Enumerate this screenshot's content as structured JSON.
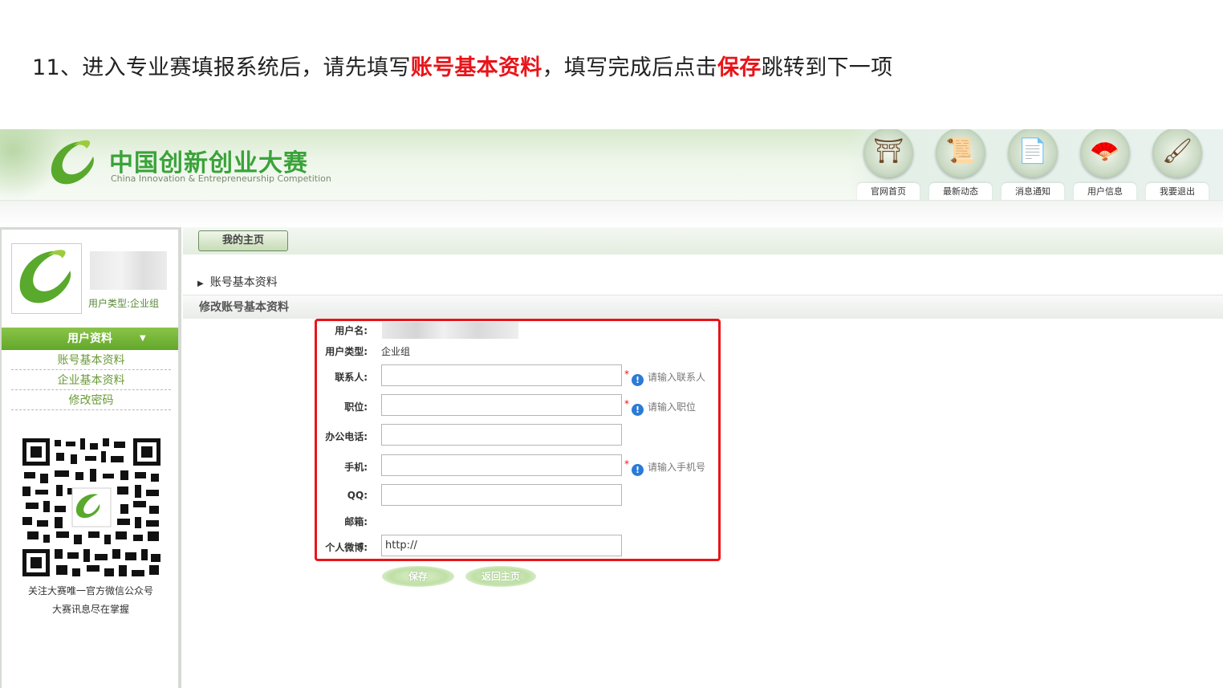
{
  "instruction": {
    "prefix": "11、进入专业赛填报系统后，请先填写",
    "highlight1": "账号基本资料",
    "middle": "，填写完成后点击",
    "highlight2": "保存",
    "suffix": "跳转到下一项"
  },
  "header": {
    "brand_cn": "中国创新创业大赛",
    "brand_en": "China Innovation & Entrepreneurship Competition",
    "nav": [
      {
        "label": "官网首页",
        "icon": "pavilion-icon"
      },
      {
        "label": "最新动态",
        "icon": "scroll-icon"
      },
      {
        "label": "消息通知",
        "icon": "paper-brush-icon"
      },
      {
        "label": "用户信息",
        "icon": "fan-icon"
      },
      {
        "label": "我要退出",
        "icon": "brush-exit-icon"
      }
    ]
  },
  "sidebar": {
    "user_type": "用户类型:企业组",
    "menu_title": "用户资料",
    "items": [
      "账号基本资料",
      "企业基本资料",
      "修改密码"
    ],
    "qr_caption1": "关注大赛唯一官方微信公众号",
    "qr_caption2": "大赛讯息尽在掌握"
  },
  "main": {
    "tab": "我的主页",
    "breadcrumb": "账号基本资料",
    "section_title": "修改账号基本资料"
  },
  "form": {
    "username_label": "用户名:",
    "usertype_label": "用户类型:",
    "usertype_value": "企业组",
    "contact_label": "联系人:",
    "contact_hint": "请输入联系人",
    "position_label": "职位:",
    "position_hint": "请输入职位",
    "office_phone_label": "办公电话:",
    "mobile_label": "手机:",
    "mobile_hint": "请输入手机号",
    "qq_label": "QQ:",
    "email_label": "邮箱:",
    "weibo_label": "个人微博:",
    "weibo_value": "http://",
    "required_mark": "*",
    "info_icon_glyph": "!"
  },
  "buttons": {
    "save": "保存",
    "back": "返回主页"
  },
  "colors": {
    "accent_red": "#e8141a",
    "brand_green": "#3aa33a",
    "menu_green": "#62a82a"
  }
}
